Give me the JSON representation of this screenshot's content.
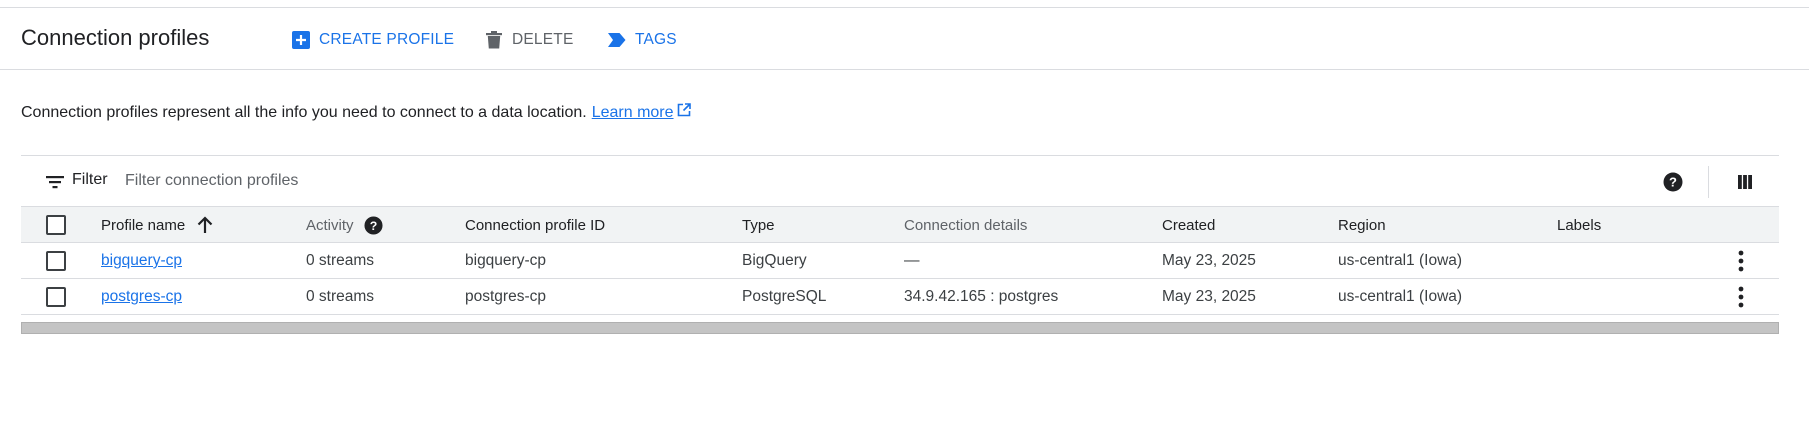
{
  "header": {
    "title": "Connection profiles",
    "actions": {
      "create_label": "CREATE PROFILE",
      "delete_label": "DELETE",
      "tags_label": "TAGS"
    }
  },
  "description": {
    "text": "Connection profiles represent all the info you need to connect to a data location.",
    "link_label": "Learn more"
  },
  "filter": {
    "label": "Filter",
    "placeholder": "Filter connection profiles"
  },
  "table": {
    "columns": {
      "profile_name": "Profile name",
      "activity": "Activity",
      "connection_profile_id": "Connection profile ID",
      "type": "Type",
      "connection_details": "Connection details",
      "created": "Created",
      "region": "Region",
      "labels": "Labels"
    },
    "rows": [
      {
        "profile_name": "bigquery-cp",
        "activity": "0 streams",
        "connection_profile_id": "bigquery-cp",
        "type": "BigQuery",
        "connection_details": "—",
        "created": "May 23, 2025",
        "region": "us-central1 (Iowa)",
        "labels": ""
      },
      {
        "profile_name": "postgres-cp",
        "activity": "0 streams",
        "connection_profile_id": "postgres-cp",
        "type": "PostgreSQL",
        "connection_details": "34.9.42.165 : postgres",
        "created": "May 23, 2025",
        "region": "us-central1 (Iowa)",
        "labels": ""
      }
    ]
  },
  "colors": {
    "accent": "#1a73e8",
    "text": "#202124",
    "muted": "#5f6368",
    "border": "#dadce0",
    "header_bg": "#f1f3f4"
  },
  "icons": {
    "create": "add-box-icon",
    "delete": "trash-icon",
    "tags": "label-icon",
    "external": "external-link-icon",
    "filter": "filter-list-icon",
    "help": "help-icon",
    "columns": "column-display-icon",
    "sort": "arrow-up-icon",
    "row_menu": "more-vert-icon"
  }
}
